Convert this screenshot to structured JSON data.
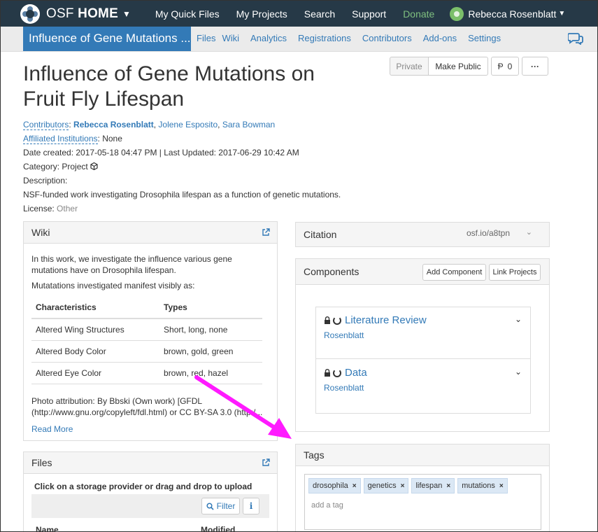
{
  "topnav": {
    "brand_prefix": "OSF",
    "brand_bold": "HOME",
    "links": [
      "My Quick Files",
      "My Projects",
      "Search",
      "Support",
      "Donate"
    ],
    "user_name": "Rebecca Rosenblatt",
    "colors": {
      "bar": "#263947",
      "donate": "#7fbf7f"
    }
  },
  "projnav": {
    "title": "Influence of Gene Mutations ...",
    "links": [
      "Files",
      "Wiki",
      "Analytics",
      "Registrations",
      "Contributors",
      "Add-ons",
      "Settings"
    ],
    "chat_icon": "chat-bubbles-icon"
  },
  "header": {
    "title": "Influence of Gene Mutations on Fruit Fly Lifespan",
    "buttons": {
      "private": "Private",
      "make_public": "Make Public",
      "fork_count": "0",
      "fork_icon": "fork-icon",
      "more": "···"
    }
  },
  "meta": {
    "contributors_label": "Contributors",
    "contributors": [
      "Rebecca Rosenblatt",
      "Jolene Esposito",
      "Sara Bowman"
    ],
    "affiliated_label": "Affiliated Institutions",
    "affiliated_value": "None",
    "dates": "Date created: 2017-05-18 04:47 PM | Last Updated: 2017-06-29 10:42 AM",
    "category_label": "Category:",
    "category_value": "Project",
    "category_icon": "cube-icon",
    "description_label": "Description:",
    "description": "NSF-funded work investigating Drosophila lifespan as a function of genetic mutations.",
    "license_label": "License:",
    "license_value": "Other"
  },
  "wiki": {
    "title": "Wiki",
    "intro": "In this work, we investigate the influence various gene mutations have on Drosophila lifespan.",
    "sub": "Mutatations investigated manifest visibly as:",
    "table": {
      "headers": [
        "Characteristics",
        "Types"
      ],
      "rows": [
        [
          "Altered Wing Structures",
          "Short, long, none"
        ],
        [
          "Altered Body Color",
          "brown, gold, green"
        ],
        [
          "Altered Eye Color",
          "brown, red, hazel"
        ]
      ]
    },
    "attribution": "Photo attribution: By Bbski (Own work) [GFDL (http://www.gnu.org/copyleft/fdl.html) or CC BY-SA 3.0 (http:/...",
    "read_more": "Read More"
  },
  "citation": {
    "title": "Citation",
    "url": "osf.io/a8tpn"
  },
  "components": {
    "title": "Components",
    "add_button": "Add Component",
    "link_button": "Link Projects",
    "items": [
      {
        "title": "Literature Review",
        "owner": "Rosenblatt"
      },
      {
        "title": "Data",
        "owner": "Rosenblatt"
      }
    ]
  },
  "tags": {
    "title": "Tags",
    "items": [
      "drosophila",
      "genetics",
      "lifespan",
      "mutations"
    ],
    "placeholder": "add a tag"
  },
  "files": {
    "title": "Files",
    "hint": "Click on a storage provider or drag and drop to upload",
    "filter": "Filter",
    "info": "i",
    "columns": [
      "Name",
      "Modified"
    ]
  }
}
